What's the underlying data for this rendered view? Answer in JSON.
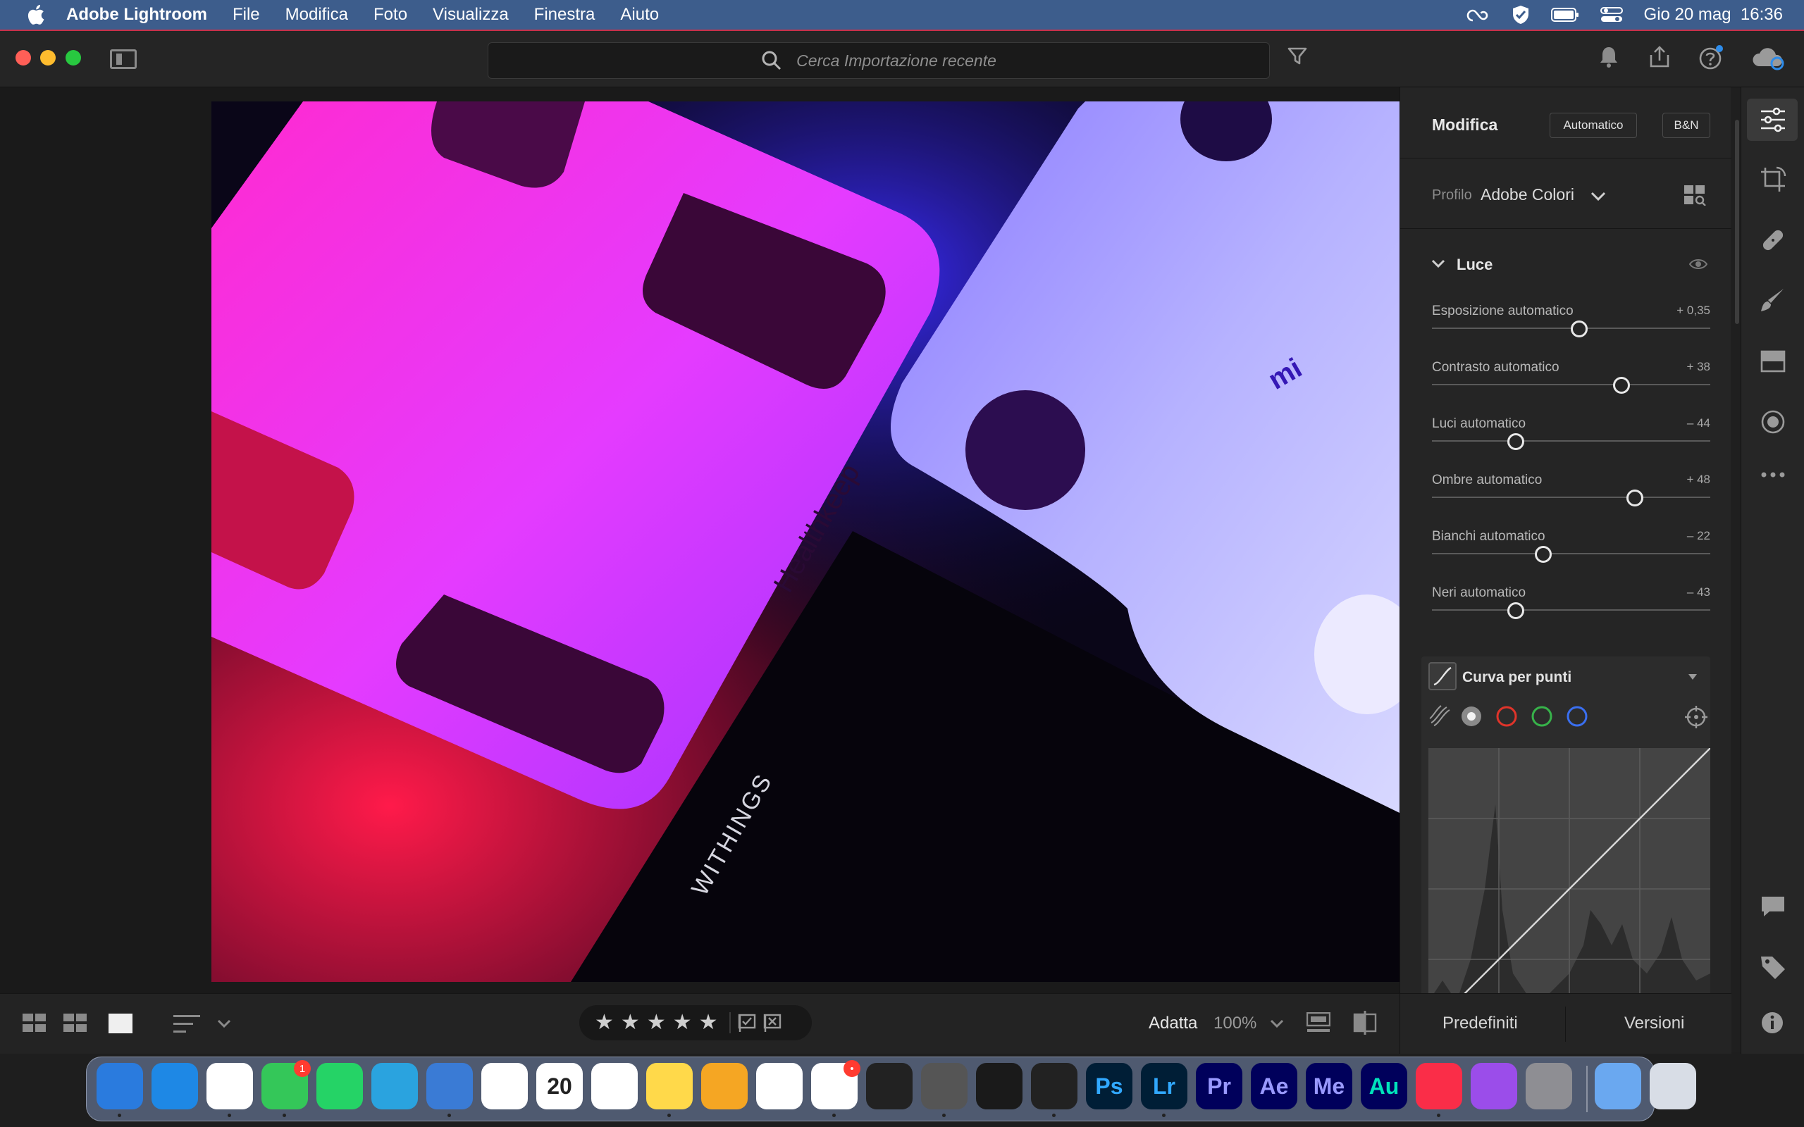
{
  "menubar": {
    "app_name": "Adobe Lightroom",
    "menus": [
      "File",
      "Modifica",
      "Foto",
      "Visualizza",
      "Finestra",
      "Aiuto"
    ],
    "clock": "Gio 20 mag  16:36"
  },
  "toolbar": {
    "search_placeholder": "Cerca Importazione recente"
  },
  "photo": {
    "brand_healthkeep": "Healthkeep",
    "brand_withings": "WITHINGS",
    "brand_mi": "mi"
  },
  "bottombar": {
    "rating_stars": [
      "★",
      "★",
      "★",
      "★",
      "★"
    ],
    "zoom_label": "Adatta",
    "zoom_value": "100%"
  },
  "edit_panel": {
    "title": "Modifica",
    "auto_button": "Automatico",
    "bw_button": "B&N",
    "profile_label": "Profilo",
    "profile_value": "Adobe Colori",
    "light_section": "Luce",
    "sliders": [
      {
        "label": "Esposizione automatico",
        "value": "+ 0,35",
        "position": 0.53
      },
      {
        "label": "Contrasto automatico",
        "value": "+ 38",
        "position": 0.68
      },
      {
        "label": "Luci automatico",
        "value": "– 44",
        "position": 0.3
      },
      {
        "label": "Ombre automatico",
        "value": "+ 48",
        "position": 0.73
      },
      {
        "label": "Bianchi automatico",
        "value": "– 22",
        "position": 0.4
      },
      {
        "label": "Neri automatico",
        "value": "– 43",
        "position": 0.3
      }
    ],
    "curve_title": "Curva per punti",
    "footer_presets": "Predefiniti",
    "footer_versions": "Versioni"
  },
  "dock": {
    "apps": [
      {
        "name": "Finder",
        "label": "",
        "color": "#2a7bde",
        "running": true
      },
      {
        "name": "Safari",
        "label": "",
        "color": "#1e88e5",
        "running": false
      },
      {
        "name": "Chrome",
        "label": "",
        "color": "#ffffff",
        "running": true
      },
      {
        "name": "Messages",
        "label": "",
        "color": "#34c759",
        "running": true,
        "badge": "1"
      },
      {
        "name": "WhatsApp",
        "label": "",
        "color": "#25d366",
        "running": false
      },
      {
        "name": "Telegram",
        "label": "",
        "color": "#2aa3df",
        "running": false
      },
      {
        "name": "Spark",
        "label": "",
        "color": "#3a7bd5",
        "running": true
      },
      {
        "name": "Photos",
        "label": "",
        "color": "#ffffff",
        "running": false
      },
      {
        "name": "Calendar",
        "label": "20",
        "color": "#ffffff",
        "running": false
      },
      {
        "name": "Reminders",
        "label": "",
        "color": "#ffffff",
        "running": false
      },
      {
        "name": "Notes",
        "label": "",
        "color": "#ffd94a",
        "running": true
      },
      {
        "name": "Pages",
        "label": "",
        "color": "#f5a623",
        "running": false
      },
      {
        "name": "Numbers",
        "label": "",
        "color": "#ffffff",
        "running": false
      },
      {
        "name": "Slack",
        "label": "",
        "color": "#ffffff",
        "running": true,
        "badge": "•"
      },
      {
        "name": "Final Cut Pro",
        "label": "",
        "color": "#222222",
        "running": false
      },
      {
        "name": "Compressor",
        "label": "",
        "color": "#555555",
        "running": true
      },
      {
        "name": "DaVinci Resolve",
        "label": "",
        "color": "#1a1a1a",
        "running": false
      },
      {
        "name": "Infuse",
        "label": "",
        "color": "#222222",
        "running": true
      },
      {
        "name": "Photoshop",
        "label": "Ps",
        "color": "#001e36",
        "running": false
      },
      {
        "name": "Lightroom",
        "label": "Lr",
        "color": "#001e36",
        "running": true
      },
      {
        "name": "Premiere Pro",
        "label": "Pr",
        "color": "#00005b",
        "running": false
      },
      {
        "name": "After Effects",
        "label": "Ae",
        "color": "#00005b",
        "running": false
      },
      {
        "name": "Media Encoder",
        "label": "Me",
        "color": "#00005b",
        "running": false
      },
      {
        "name": "Audition",
        "label": "Au",
        "color": "#00005b",
        "running": false
      },
      {
        "name": "Music",
        "label": "",
        "color": "#fa2d48",
        "running": true
      },
      {
        "name": "Podcasts",
        "label": "",
        "color": "#9b4dea",
        "running": false
      },
      {
        "name": "System Preferences",
        "label": "",
        "color": "#8e8e93",
        "running": false
      },
      {
        "name": "Downloads",
        "label": "",
        "color": "#6aa8f0",
        "running": false
      },
      {
        "name": "Trash",
        "label": "",
        "color": "#d8dde6",
        "running": false
      }
    ]
  }
}
